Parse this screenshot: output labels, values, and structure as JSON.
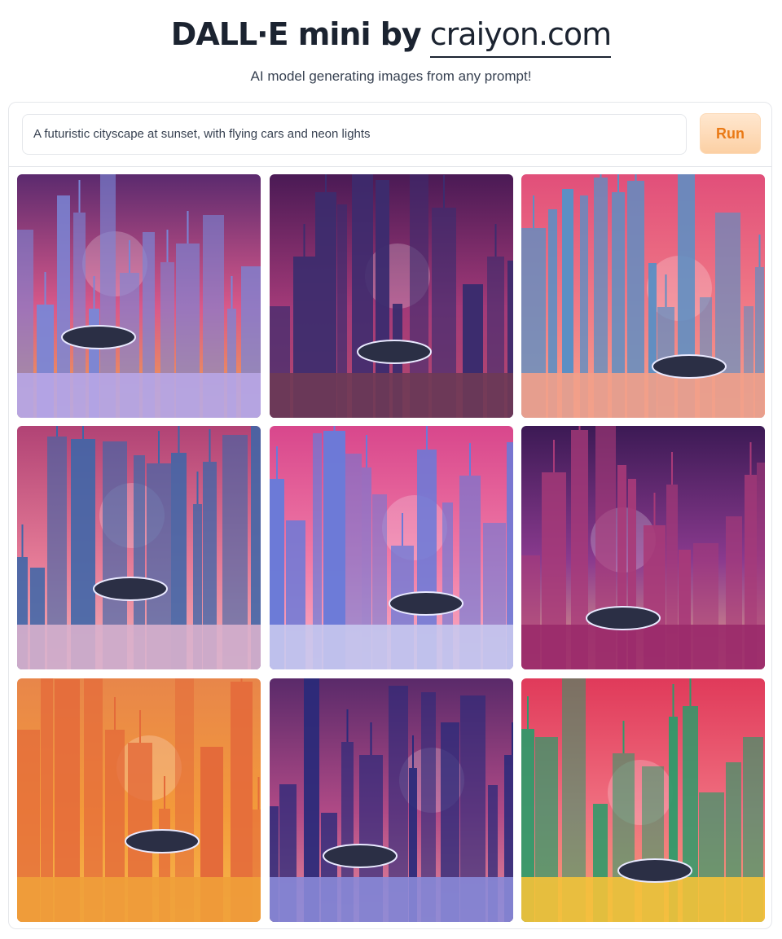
{
  "header": {
    "title_bold": "DALL·E mini by",
    "title_domain": "craiyon.com",
    "subtitle": "AI model generating images from any prompt!"
  },
  "prompt": {
    "value": "A futuristic cityscape at sunset, with flying cars and neon lights",
    "run_label": "Run"
  },
  "results": [
    {
      "name": "result-image-1",
      "sky_top": "#5b2a6e",
      "sky_mid": "#d9598a",
      "sky_bottom": "#f4a64a",
      "building": "#7a86d6",
      "ground": "#b8a6e6"
    },
    {
      "name": "result-image-2",
      "sky_top": "#4a1a55",
      "sky_mid": "#a33a78",
      "sky_bottom": "#b64a6e",
      "building": "#3c2c6e",
      "ground": "#6e3a55"
    },
    {
      "name": "result-image-3",
      "sky_top": "#e14f7a",
      "sky_mid": "#f07a86",
      "sky_bottom": "#f6a48a",
      "building": "#5c8fc4",
      "ground": "#f2a08a"
    },
    {
      "name": "result-image-4",
      "sky_top": "#b14375",
      "sky_mid": "#e47a96",
      "sky_bottom": "#f2b0b6",
      "building": "#3e66a8",
      "ground": "#d8b0cc"
    },
    {
      "name": "result-image-5",
      "sky_top": "#d8478c",
      "sky_mid": "#f07aa6",
      "sky_bottom": "#fab2c4",
      "building": "#6a7ad8",
      "ground": "#c8c8ee"
    },
    {
      "name": "result-image-6",
      "sky_top": "#3c1a55",
      "sky_mid": "#8a3a8e",
      "sky_bottom": "#e39a8a",
      "building": "#a83a78",
      "ground": "#9a2a6a"
    },
    {
      "name": "result-image-7",
      "sky_top": "#e8864a",
      "sky_mid": "#f39a3a",
      "sky_bottom": "#f7b84a",
      "building": "#e46a3a",
      "ground": "#f0a03a"
    },
    {
      "name": "result-image-8",
      "sky_top": "#5a2a6a",
      "sky_mid": "#b04a86",
      "sky_bottom": "#e88a9a",
      "building": "#2a2a7a",
      "ground": "#8a8ad8"
    },
    {
      "name": "result-image-9",
      "sky_top": "#e03a5a",
      "sky_mid": "#f07080",
      "sky_bottom": "#f3a070",
      "building": "#2e9a6a",
      "ground": "#f4c23a"
    }
  ]
}
